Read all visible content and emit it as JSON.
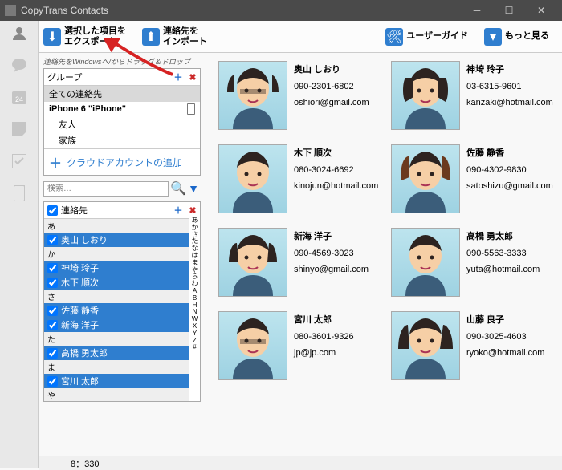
{
  "window": {
    "title": "CopyTrans Contacts"
  },
  "toolbar": {
    "export_l1": "選択した項目を",
    "export_l2": "エクスポート",
    "import_l1": "連絡先を",
    "import_l2": "インポート",
    "userguide": "ユーザーガイド",
    "more": "もっと見る"
  },
  "hint": "連絡先をWindowsへ/からドラッグ＆ドロップ",
  "groups": {
    "header": "グループ",
    "items": [
      {
        "label": "全ての連絡先",
        "selected": true
      },
      {
        "label": "iPhone 6 \"iPhone\"",
        "bold": true,
        "phone": true
      },
      {
        "label": "友人",
        "indent": true
      },
      {
        "label": "家族",
        "indent": true
      }
    ],
    "add_cloud": "クラウドアカウントの追加"
  },
  "search": {
    "placeholder": "検索…"
  },
  "contacts_list": {
    "header": "連絡先",
    "rows": [
      {
        "type": "idx",
        "label": "あ"
      },
      {
        "type": "c",
        "label": "奥山 しおり",
        "sel": true
      },
      {
        "type": "idx",
        "label": "か"
      },
      {
        "type": "c",
        "label": "神埼 玲子",
        "sel": true
      },
      {
        "type": "c",
        "label": "木下 順次",
        "sel": true
      },
      {
        "type": "idx",
        "label": "さ"
      },
      {
        "type": "c",
        "label": "佐藤 静香",
        "sel": true
      },
      {
        "type": "c",
        "label": "新海 洋子",
        "sel": true
      },
      {
        "type": "idx",
        "label": "た"
      },
      {
        "type": "c",
        "label": "高橋 勇太郎",
        "sel": true
      },
      {
        "type": "idx",
        "label": "ま"
      },
      {
        "type": "c",
        "label": "宮川 太郎",
        "sel": true
      },
      {
        "type": "idx",
        "label": "や"
      },
      {
        "type": "c",
        "label": "山藤 良子",
        "sel": true
      },
      {
        "type": "idx",
        "label": "A"
      }
    ],
    "index_bar": [
      "あ",
      "か",
      "さ",
      "た",
      "な",
      "は",
      "ま",
      "や",
      "ら",
      "わ",
      "A",
      "B",
      "H",
      "N",
      "W",
      "X",
      "Y",
      "Z",
      "#"
    ]
  },
  "cards": [
    {
      "name": "奥山 しおり",
      "phone": "090-2301-6802",
      "email": "oshiori@gmail.com",
      "face": "f1"
    },
    {
      "name": "神埼 玲子",
      "phone": "03-6315-9601",
      "email": "kanzaki@hotmail.com",
      "face": "f2"
    },
    {
      "name": "木下 順次",
      "phone": "080-3024-6692",
      "email": "kinojun@hotmail.com",
      "face": "m1"
    },
    {
      "name": "佐藤 静香",
      "phone": "090-4302-9830",
      "email": "satoshizu@gmail.com",
      "face": "f3"
    },
    {
      "name": "新海 洋子",
      "phone": "090-4569-3023",
      "email": "shinyo@gmail.com",
      "face": "f4"
    },
    {
      "name": "高橋 勇太郎",
      "phone": "090-5563-3333",
      "email": "yuta@hotmail.com",
      "face": "m2"
    },
    {
      "name": "宮川 太郎",
      "phone": "080-3601-9326",
      "email": "jp@jp.com",
      "face": "m3"
    },
    {
      "name": "山藤 良子",
      "phone": "090-3025-4603",
      "email": "ryoko@hotmail.com",
      "face": "f5"
    }
  ],
  "status": "8：330"
}
